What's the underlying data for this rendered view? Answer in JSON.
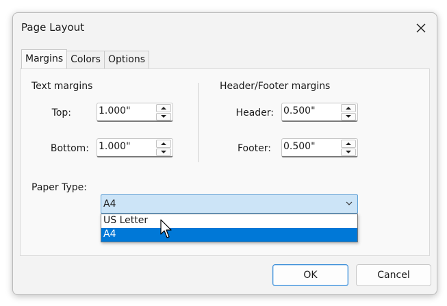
{
  "window": {
    "title": "Page Layout"
  },
  "tabs": [
    {
      "label": "Margins",
      "active": true
    },
    {
      "label": "Colors",
      "active": false
    },
    {
      "label": "Options",
      "active": false
    }
  ],
  "text_margins": {
    "heading": "Text margins",
    "top": {
      "label": "Top:",
      "value": "1.000\""
    },
    "bottom": {
      "label": "Bottom:",
      "value": "1.000\""
    }
  },
  "header_footer_margins": {
    "heading": "Header/Footer margins",
    "header": {
      "label": "Header:",
      "value": "0.500\""
    },
    "footer": {
      "label": "Footer:",
      "value": "0.500\""
    }
  },
  "paper_type": {
    "label": "Paper Type:",
    "selected": "A4",
    "options": [
      "US Letter",
      "A4"
    ],
    "highlighted": "A4"
  },
  "buttons": {
    "ok": "OK",
    "cancel": "Cancel"
  },
  "colors": {
    "accent": "#0078d7",
    "select_bg": "#cce4f7",
    "dialog_bg": "#f3f3f3"
  },
  "icons": {
    "close": "close-icon",
    "spin_up": "caret-up-icon",
    "spin_down": "caret-down-icon",
    "chevron": "chevron-down-icon",
    "cursor": "mouse-pointer-icon"
  }
}
